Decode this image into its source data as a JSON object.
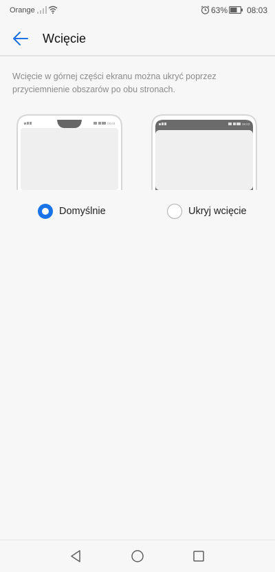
{
  "status_bar": {
    "carrier": "Orange",
    "battery_percent": "63%",
    "time": "08:03",
    "icons": [
      "signal-icon",
      "wifi-icon",
      "alarm-icon",
      "battery-icon"
    ]
  },
  "app_bar": {
    "title": "Wcięcie",
    "back_icon": "arrow-left-icon"
  },
  "description": "Wcięcie w górnej części ekranu można ukryć poprzez przyciemnienie obszarów po obu stronach.",
  "options": [
    {
      "label": "Domyślnie",
      "selected": true
    },
    {
      "label": "Ukryj wcięcie",
      "selected": false
    }
  ],
  "preview_time": "08:03",
  "nav_bar": {
    "buttons": [
      "triangle-back-icon",
      "circle-home-icon",
      "square-recent-icon"
    ]
  },
  "colors": {
    "accent": "#1a73e8",
    "background": "#f7f7f7",
    "notch": "#666666"
  }
}
